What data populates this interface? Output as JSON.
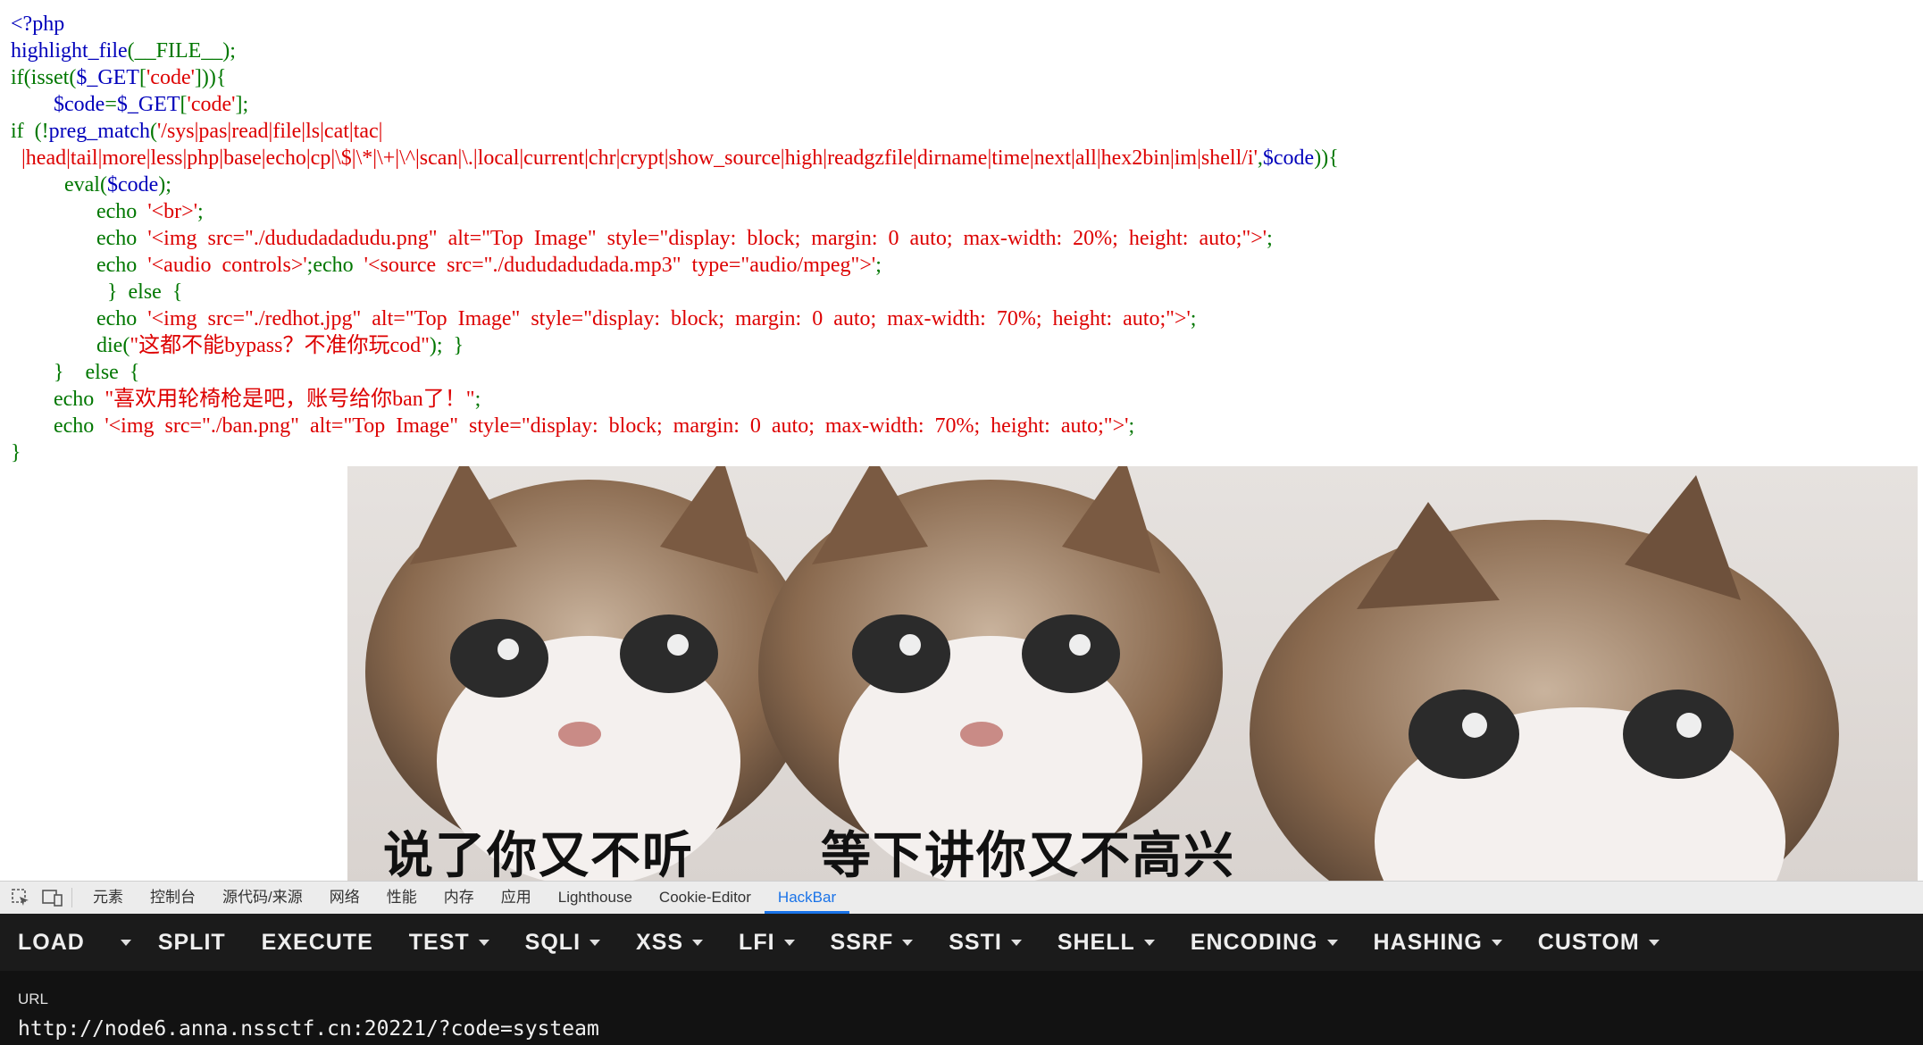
{
  "code": {
    "l1": "<?php",
    "l2_fn": "highlight_file",
    "l2_p": "(__FILE__);",
    "l3_kw": "if(isset(",
    "l3_v": "$_GET",
    "l3_p1": "[",
    "l3_s": "'code'",
    "l3_p2": "])){",
    "l4_v1": "$code",
    "l4_eq": "=",
    "l4_v2": "$_GET",
    "l4_p1": "[",
    "l4_s": "'code'",
    "l4_p2": "];",
    "l5_kw": "if  (!",
    "l5_fn": "preg_match",
    "l5_p": "(",
    "l5_s": "'/sys|pas|read|file|ls|cat|tac|",
    "l6_s": "|head|tail|more|less|php|base|echo|cp|\\$|\\*|\\+|\\^|scan|\\.|local|current|chr|crypt|show_source|high|readgzfile|dirname|time|next|all|hex2bin|im|shell/i'",
    "l6_p1": ",",
    "l6_v": "$code",
    "l6_p2": ")){",
    "l7_kw": "eval(",
    "l7_v": "$code",
    "l7_p": ");",
    "l8_kw": "echo  ",
    "l8_s": "'<br>'",
    "l8_p": ";",
    "l9_kw": "echo  ",
    "l9_s": "'<img  src=\"./dududadadudu.png\"  alt=\"Top  Image\"  style=\"display:  block;  margin:  0  auto;  max-width:  20%;  height:  auto;\">'",
    "l9_p": ";",
    "l10_kw": "echo  ",
    "l10_s1": "'<audio  controls>'",
    "l10_k2": ";echo  ",
    "l10_s2": "'<source  src=\"./dududadudada.mp3\"  type=\"audio/mpeg\">'",
    "l10_p": ";",
    "l11": "}  else  {",
    "l12_kw": "echo  ",
    "l12_s": "'<img  src=\"./redhot.jpg\"  alt=\"Top  Image\"  style=\"display:  block;  margin:  0  auto;  max-width:  70%;  height:  auto;\">'",
    "l12_p": ";",
    "l13_kw": "die(",
    "l13_s": "\"这都不能bypass？不准你玩cod\"",
    "l13_p": ");  }",
    "l14": "}    else  {",
    "l15_kw": "echo  ",
    "l15_s": "\"喜欢用轮椅枪是吧，账号给你ban了！\"",
    "l15_p": ";",
    "l16_kw": "echo  ",
    "l16_s": "'<img  src=\"./ban.png\"  alt=\"Top  Image\"  style=\"display:  block;  margin:  0  auto;  max-width:  70%;  height:  auto;\">'",
    "l16_p": ";",
    "l17": "}"
  },
  "image": {
    "caption_left": "说了你又不听",
    "caption_right": "等下讲你又不高兴"
  },
  "devtools": {
    "tabs": [
      "元素",
      "控制台",
      "源代码/来源",
      "网络",
      "性能",
      "内存",
      "应用",
      "Lighthouse",
      "Cookie-Editor",
      "HackBar"
    ],
    "active_tab": "HackBar"
  },
  "hackbar": {
    "buttons": [
      "LOAD",
      "SPLIT",
      "EXECUTE",
      "TEST",
      "SQLI",
      "XSS",
      "LFI",
      "SSRF",
      "SSTI",
      "SHELL",
      "ENCODING",
      "HASHING",
      "CUSTOM"
    ],
    "url_label": "URL",
    "url_value": "http://node6.anna.nssctf.cn:20221/?code=systeam"
  }
}
